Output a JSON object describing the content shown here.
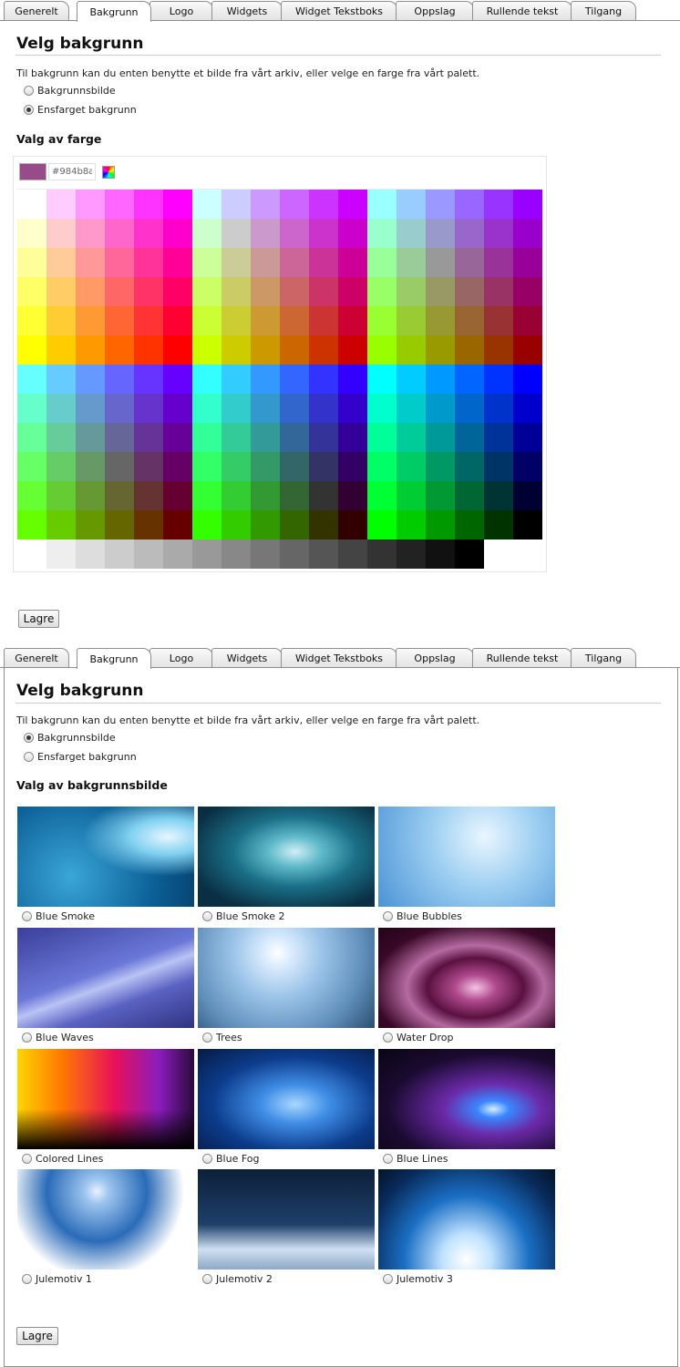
{
  "tabs": [
    {
      "label": "Generelt"
    },
    {
      "label": "Bakgrunn"
    },
    {
      "label": "Logo"
    },
    {
      "label": "Widgets"
    },
    {
      "label": "Widget Tekstboks"
    },
    {
      "label": "Oppslag"
    },
    {
      "label": "Rullende tekst"
    },
    {
      "label": "Tilgang"
    }
  ],
  "active_tab": "Bakgrunn",
  "heading": "Velg bakgrunn",
  "intro": "Til bakgrunn kan du enten benytte et bilde fra vårt arkiv, eller velge en farge fra vårt palett.",
  "options": {
    "image": "Bakgrunnsbilde",
    "color": "Ensfarget bakgrunn"
  },
  "color_panel": {
    "selected_option": "Ensfarget bakgrunn",
    "section_title": "Valg av farge",
    "selected_hex": "#984b8a",
    "wheel_icon": "color-wheel-icon",
    "palette_rows": [
      [
        "#ffffff",
        "#ffccff",
        "#ff99ff",
        "#ff66ff",
        "#ff33ff",
        "#ff00ff",
        "#ccffff",
        "#ccccff",
        "#cc99ff",
        "#cc66ff",
        "#cc33ff",
        "#cc00ff",
        "#99ffff",
        "#99ccff",
        "#9999ff",
        "#9966ff",
        "#9933ff",
        "#9900ff"
      ],
      [
        "#ffffcc",
        "#ffcccc",
        "#ff99cc",
        "#ff66cc",
        "#ff33cc",
        "#ff00cc",
        "#ccffcc",
        "#cccccc",
        "#cc99cc",
        "#cc66cc",
        "#cc33cc",
        "#cc00cc",
        "#99ffcc",
        "#99cccc",
        "#9999cc",
        "#9966cc",
        "#9933cc",
        "#9900cc"
      ],
      [
        "#ffff99",
        "#ffcc99",
        "#ff9999",
        "#ff6699",
        "#ff3399",
        "#ff0099",
        "#ccff99",
        "#cccc99",
        "#cc9999",
        "#cc6699",
        "#cc3399",
        "#cc0099",
        "#99ff99",
        "#99cc99",
        "#999999",
        "#996699",
        "#993399",
        "#990099"
      ],
      [
        "#ffff66",
        "#ffcc66",
        "#ff9966",
        "#ff6666",
        "#ff3366",
        "#ff0066",
        "#ccff66",
        "#cccc66",
        "#cc9966",
        "#cc6666",
        "#cc3366",
        "#cc0066",
        "#99ff66",
        "#99cc66",
        "#999966",
        "#996666",
        "#993366",
        "#990066"
      ],
      [
        "#ffff33",
        "#ffcc33",
        "#ff9933",
        "#ff6633",
        "#ff3333",
        "#ff0033",
        "#ccff33",
        "#cccc33",
        "#cc9933",
        "#cc6633",
        "#cc3333",
        "#cc0033",
        "#99ff33",
        "#99cc33",
        "#999933",
        "#996633",
        "#993333",
        "#990033"
      ],
      [
        "#ffff00",
        "#ffcc00",
        "#ff9900",
        "#ff6600",
        "#ff3300",
        "#ff0000",
        "#ccff00",
        "#cccc00",
        "#cc9900",
        "#cc6600",
        "#cc3300",
        "#cc0000",
        "#99ff00",
        "#99cc00",
        "#999900",
        "#996600",
        "#993300",
        "#990000"
      ],
      [
        "#66ffff",
        "#66ccff",
        "#6699ff",
        "#6666ff",
        "#6633ff",
        "#6600ff",
        "#33ffff",
        "#33ccff",
        "#3399ff",
        "#3366ff",
        "#3333ff",
        "#3300ff",
        "#00ffff",
        "#00ccff",
        "#0099ff",
        "#0066ff",
        "#0033ff",
        "#0000ff"
      ],
      [
        "#66ffcc",
        "#66cccc",
        "#6699cc",
        "#6666cc",
        "#6633cc",
        "#6600cc",
        "#33ffcc",
        "#33cccc",
        "#3399cc",
        "#3366cc",
        "#3333cc",
        "#3300cc",
        "#00ffcc",
        "#00cccc",
        "#0099cc",
        "#0066cc",
        "#0033cc",
        "#0000cc"
      ],
      [
        "#66ff99",
        "#66cc99",
        "#669999",
        "#666699",
        "#663399",
        "#660099",
        "#33ff99",
        "#33cc99",
        "#339999",
        "#336699",
        "#333399",
        "#330099",
        "#00ff99",
        "#00cc99",
        "#009999",
        "#006699",
        "#003399",
        "#000099"
      ],
      [
        "#66ff66",
        "#66cc66",
        "#669966",
        "#666666",
        "#663366",
        "#660066",
        "#33ff66",
        "#33cc66",
        "#339966",
        "#336666",
        "#333366",
        "#330066",
        "#00ff66",
        "#00cc66",
        "#009966",
        "#006666",
        "#003366",
        "#000066"
      ],
      [
        "#66ff33",
        "#66cc33",
        "#669933",
        "#666633",
        "#663333",
        "#660033",
        "#33ff33",
        "#33cc33",
        "#339933",
        "#336633",
        "#333333",
        "#330033",
        "#00ff33",
        "#00cc33",
        "#009933",
        "#006633",
        "#003333",
        "#000033"
      ],
      [
        "#66ff00",
        "#66cc00",
        "#669900",
        "#666600",
        "#663300",
        "#660000",
        "#33ff00",
        "#33cc00",
        "#339900",
        "#336600",
        "#333300",
        "#330000",
        "#00ff00",
        "#00cc00",
        "#009900",
        "#006600",
        "#003300",
        "#000000"
      ],
      [
        "#ffffff",
        "#eeeeee",
        "#dddddd",
        "#cccccc",
        "#bbbbbb",
        "#aaaaaa",
        "#999999",
        "#888888",
        "#777777",
        "#666666",
        "#555555",
        "#444444",
        "#333333",
        "#222222",
        "#111111",
        "#000000"
      ]
    ],
    "save_label": "Lagre"
  },
  "image_panel": {
    "selected_option": "Bakgrunnsbilde",
    "section_title": "Valg av bakgrunnsbilde",
    "images": [
      {
        "name": "Blue Smoke",
        "bg": "radial-gradient(ellipse at 85% 30%, #e8f6ff 0%, #7fd0f0 18%, transparent 40%), radial-gradient(circle at 30% 70%, #3aa6d8, #0b5f96 60%, #063a66)"
      },
      {
        "name": "Blue Smoke 2",
        "bg": "radial-gradient(ellipse at 55% 45%, #cfeff6 0%, #5cb8c8 20%, #1a6f86 45%, #0a2f44 80%)"
      },
      {
        "name": "Blue Bubbles",
        "bg": "radial-gradient(circle at 60% 30%, #eaf6ff, #9fd0f2 40%, #4a93d6 100%)"
      },
      {
        "name": "Blue Waves",
        "bg": "linear-gradient(160deg, #3a3f9a 0%, #6b78d8 45%, #b9c3f4 55%, #5a62c2 70%, #2f3380 100%)"
      },
      {
        "name": "Trees",
        "bg": "radial-gradient(circle at 45% 25%, #ffffff 0%, #dfeeff 10%, #9ec6ea 35%, #5f8fbb 70%, #2c4d6e 100%)"
      },
      {
        "name": "Water Drop",
        "bg": "radial-gradient(ellipse at 55% 60%, #f3c4e4 0%, #b04a8e 15%, #5a1140 35%, #b56aa0 50%, #3a0828 75%, #220418 100%)"
      },
      {
        "name": "Colored Lines",
        "bg": "linear-gradient(180deg, transparent 0%, transparent 60%, #000 100%), linear-gradient(90deg, #ffd400, #ff7a00 25%, #e8105a 55%, #8a1dbd 80%, #2a0a3a)"
      },
      {
        "name": "Blue Fog",
        "bg": "radial-gradient(ellipse at 55% 55%, #a9d8ff 0%, #3f8de6 25%, #0c3c8c 60%, #061a44 100%)"
      },
      {
        "name": "Blue Lines",
        "bg": "radial-gradient(ellipse at 65% 60%, #d8f0ff 0%, #3a86ff 10%, #6b2aa8 30%, #1a0a30 65%, #0a0614 100%)"
      },
      {
        "name": "Julemotiv 1",
        "bg": "radial-gradient(circle at 45% 22%, #eaf2ff 0%, #9cc4ee 10%, #2a6bb8 40%, #ffffff 70%)"
      },
      {
        "name": "Julemotiv 2",
        "bg": "linear-gradient(180deg, #0c1f3a 0%, #1e3f6a 55%, #cfe0f2 80%, #8ea8c6 100%)"
      },
      {
        "name": "Julemotiv 3",
        "bg": "radial-gradient(ellipse at 50% 90%, #ffffff 0%, #bfe2ff 20%, #1a6fc4 50%, #082a5a 80%, #041428 100%)"
      }
    ],
    "save_label": "Lagre"
  }
}
